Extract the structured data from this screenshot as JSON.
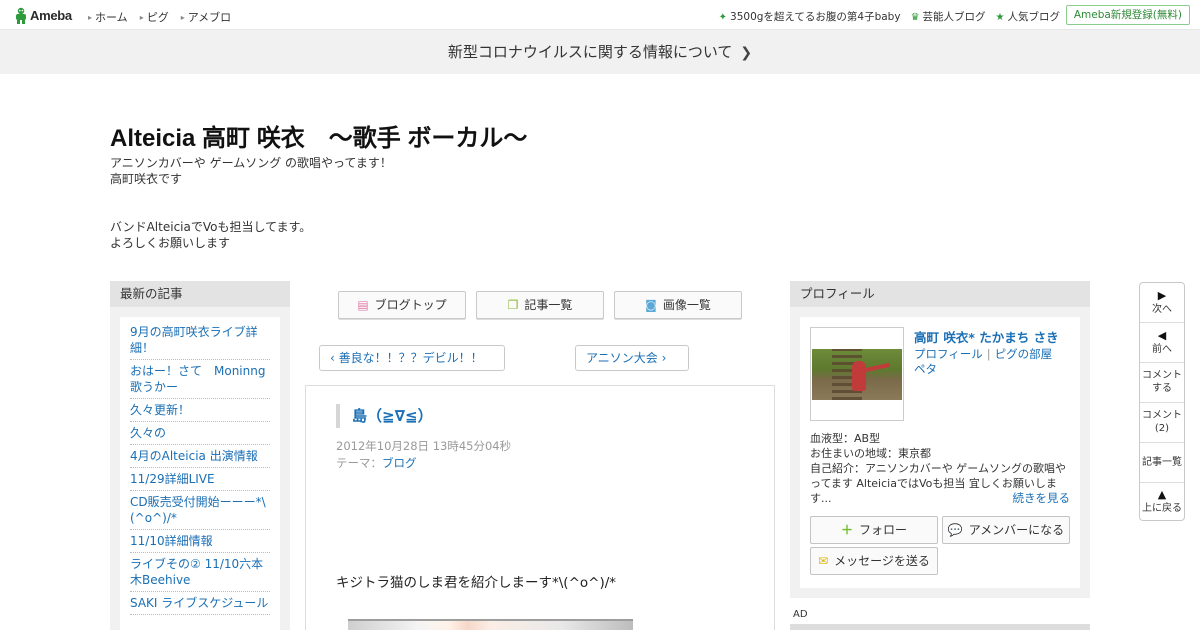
{
  "topbar": {
    "logo": "Ameba",
    "nav": [
      "ホーム",
      "ピグ",
      "アメブロ"
    ],
    "right_links": [
      {
        "icon": "sparkle-icon",
        "label": "3500gを超えてるお腹の第4子baby"
      },
      {
        "icon": "crown-icon",
        "label": "芸能人ブログ"
      },
      {
        "icon": "star-icon",
        "label": "人気ブログ"
      }
    ],
    "register_label": "Ameba新規登録(無料)"
  },
  "banner": {
    "text": "新型コロナウイルスに関する情報について"
  },
  "blog": {
    "title": "Alteicia 高町 咲衣　〜歌手 ボーカル〜",
    "description": "アニソンカバーや ゲームソング の歌唱やってます！\n高町咲衣です\n\n\nバンドAlteiciaでVoも担当してます。\nよろしくお願いします"
  },
  "left_sidebar": {
    "heading": "最新の記事",
    "items": [
      "9月の高町咲衣ライブ詳細！",
      "おはー！さて　Moninng歌うかー",
      "久々更新！",
      "久々の",
      "4月のAlteicia 出演情報",
      "11/29詳細LIVE",
      "CD販売受付開始ーーー*\\(^o^)/*",
      "11/10詳細情報",
      "ライブその② 11/10六本木Beehive",
      "SAKI ライブスケジュール"
    ]
  },
  "tabs": {
    "blog_top": "ブログトップ",
    "articles": "記事一覧",
    "images": "画像一覧"
  },
  "pager": {
    "prev": "善良な！！？？デビル！！",
    "next": "アニソン大会"
  },
  "article": {
    "title": "島（≧∇≦）",
    "date": "2012年10月28日 13時45分04秒",
    "theme_label": "テーマ：",
    "theme": "ブログ",
    "body": "キジトラ猫のしま君を紹介しまーす*\\(^o^)/*"
  },
  "profile": {
    "heading": "プロフィール",
    "name": "高町 咲衣* たかまち さき",
    "link_profile": "プロフィール",
    "link_pig": "ピグの部屋",
    "link_peta": "ペタ",
    "blood": "血液型：AB型",
    "location": "お住まいの地域：東京都",
    "intro": "自己紹介：アニソンカバーや ゲームソングの歌唱やってます AlteiciaではVoも担当 宜しくお願いします...",
    "more": "続きを見る",
    "follow": "フォロー",
    "amember": "アメンバーになる",
    "message": "メッセージを送る"
  },
  "ad_label": "AD",
  "float_nav": {
    "next": "次へ",
    "prev": "前へ",
    "comment_line1": "コメント",
    "comment_line2": "する",
    "comments_line1": "コメント",
    "comments_line2": "(2)",
    "article_list": "記事一覧",
    "to_top": "上に戻る"
  },
  "colors": {
    "link": "#1a6fb5",
    "ameba_green": "#2d9a3c",
    "sidebar_bg": "#f1f1f1"
  }
}
